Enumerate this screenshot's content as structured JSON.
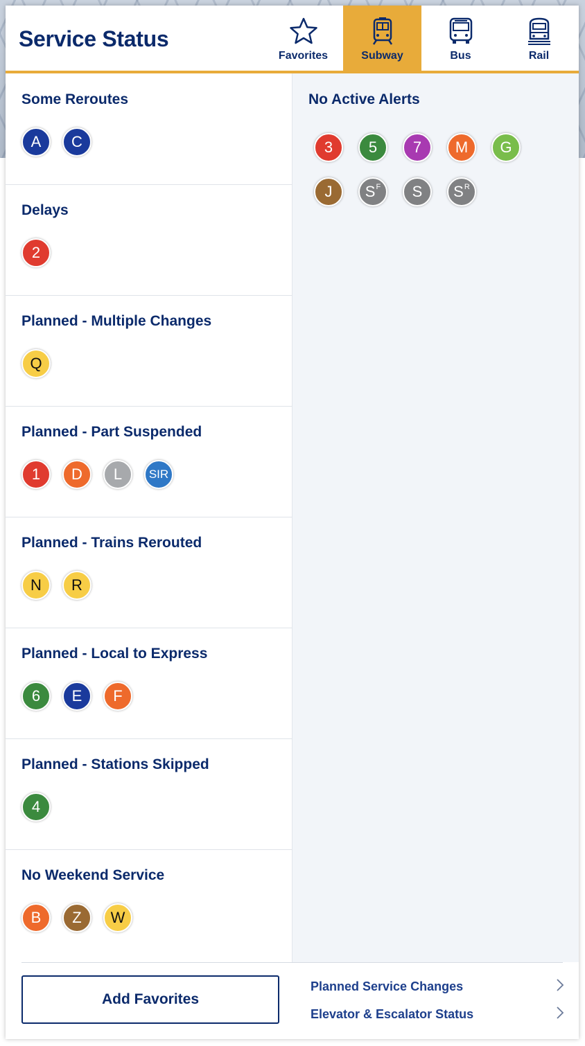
{
  "header": {
    "title": "Service Status",
    "tabs": [
      {
        "label": "Favorites",
        "icon": "star-icon",
        "active": false
      },
      {
        "label": "Subway",
        "icon": "subway-train-icon",
        "active": true
      },
      {
        "label": "Bus",
        "icon": "bus-icon",
        "active": false
      },
      {
        "label": "Rail",
        "icon": "rail-train-icon",
        "active": false
      }
    ]
  },
  "colors": {
    "accent": "#e8ab3a",
    "navy": "#0b2a6b",
    "route_blue": "#1a3a9c",
    "route_red": "#e03b2f",
    "route_orange": "#ee6a2c",
    "route_yellow": "#f7cd46",
    "route_green": "#3b8a3e",
    "route_lightgreen": "#79bd4b",
    "route_purple": "#a83ab1",
    "route_brown": "#9a6a33",
    "route_gray": "#a7a9ac",
    "route_shuttle": "#808183",
    "route_sir": "#2f78c6"
  },
  "left": {
    "sections": [
      {
        "title": "Some Reroutes",
        "routes": [
          "A",
          "C"
        ]
      },
      {
        "title": "Delays",
        "routes": [
          "2"
        ]
      },
      {
        "title": "Planned - Multiple Changes",
        "routes": [
          "Q"
        ]
      },
      {
        "title": "Planned - Part Suspended",
        "routes": [
          "1",
          "D",
          "L",
          "SIR"
        ]
      },
      {
        "title": "Planned - Trains Rerouted",
        "routes": [
          "N",
          "R"
        ]
      },
      {
        "title": "Planned - Local to Express",
        "routes": [
          "6",
          "E",
          "F"
        ]
      },
      {
        "title": "Planned - Stations Skipped",
        "routes": [
          "4"
        ]
      },
      {
        "title": "No Weekend Service",
        "routes": [
          "B",
          "Z",
          "W"
        ]
      }
    ]
  },
  "right": {
    "title": "No Active Alerts",
    "routes": [
      "3",
      "5",
      "7",
      "M",
      "G",
      "J",
      "S",
      "S",
      "S"
    ],
    "route_superscripts": [
      "",
      "",
      "",
      "",
      "",
      "",
      "F",
      "",
      "R"
    ]
  },
  "footer": {
    "add_favorites": "Add Favorites",
    "links": [
      "Planned Service Changes",
      "Elevator & Escalator Status"
    ],
    "chevron": "chevron-right-icon"
  }
}
